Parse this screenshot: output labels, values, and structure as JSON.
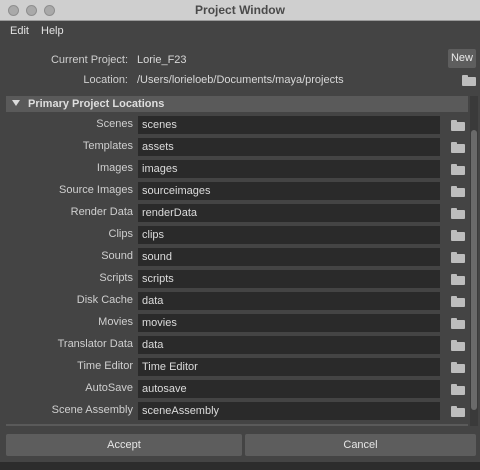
{
  "window": {
    "title": "Project Window"
  },
  "menu": [
    "Edit",
    "Help"
  ],
  "project": {
    "current_label": "Current Project:",
    "current_value": "Lorie_F23",
    "new_label": "New",
    "location_label": "Location:",
    "location_value": "/Users/lorieloeb/Documents/maya/projects"
  },
  "section": {
    "title": "Primary Project Locations"
  },
  "locations": [
    {
      "label": "Scenes",
      "value": "scenes"
    },
    {
      "label": "Templates",
      "value": "assets"
    },
    {
      "label": "Images",
      "value": "images"
    },
    {
      "label": "Source Images",
      "value": "sourceimages"
    },
    {
      "label": "Render Data",
      "value": "renderData"
    },
    {
      "label": "Clips",
      "value": "clips"
    },
    {
      "label": "Sound",
      "value": "sound"
    },
    {
      "label": "Scripts",
      "value": "scripts"
    },
    {
      "label": "Disk Cache",
      "value": "data"
    },
    {
      "label": "Movies",
      "value": "movies"
    },
    {
      "label": "Translator Data",
      "value": "data"
    },
    {
      "label": "Time Editor",
      "value": "Time Editor"
    },
    {
      "label": "AutoSave",
      "value": "autosave"
    },
    {
      "label": "Scene Assembly",
      "value": "sceneAssembly"
    }
  ],
  "buttons": {
    "accept": "Accept",
    "cancel": "Cancel"
  }
}
